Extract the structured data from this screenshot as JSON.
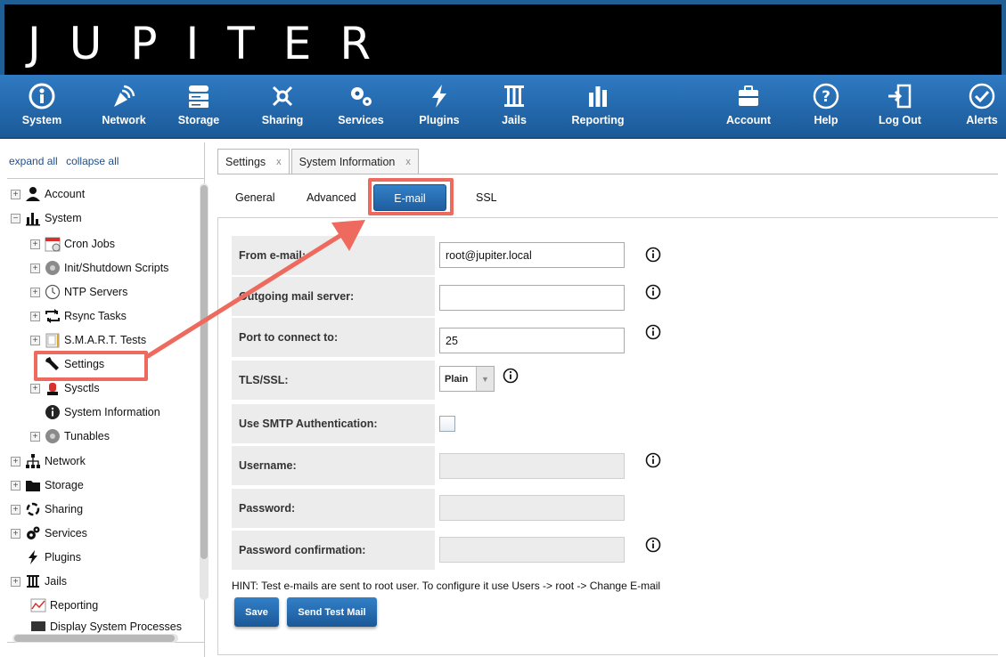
{
  "app": {
    "logo_text": "JUPITER",
    "brand_color": "#1f5f94"
  },
  "nav": {
    "items": [
      {
        "label": "System",
        "icon": "power-icon"
      },
      {
        "label": "Network",
        "icon": "satellite-icon"
      },
      {
        "label": "Storage",
        "icon": "disk-stack-icon"
      },
      {
        "label": "Sharing",
        "icon": "share-icon"
      },
      {
        "label": "Services",
        "icon": "gears-icon"
      },
      {
        "label": "Plugins",
        "icon": "lightning-icon"
      },
      {
        "label": "Jails",
        "icon": "jail-bars-icon"
      },
      {
        "label": "Reporting",
        "icon": "bar-chart-icon"
      },
      {
        "label": "Account",
        "icon": "account-icon"
      },
      {
        "label": "Help",
        "icon": "help-icon"
      },
      {
        "label": "Log Out",
        "icon": "logout-icon"
      },
      {
        "label": "Alerts",
        "icon": "check-circle-icon"
      }
    ]
  },
  "sidebar": {
    "expand_all": "expand all",
    "collapse_all": "collapse all",
    "tree": [
      {
        "label": "Account",
        "icon": "user-icon",
        "level": 0,
        "expander": "+"
      },
      {
        "label": "System",
        "icon": "chart-icon",
        "level": 0,
        "expander": "−"
      },
      {
        "label": "Cron Jobs",
        "icon": "calendar-icon",
        "level": 1,
        "expander": "+"
      },
      {
        "label": "Init/Shutdown Scripts",
        "icon": "disc-icon",
        "level": 1,
        "expander": "+"
      },
      {
        "label": "NTP Servers",
        "icon": "clock-icon",
        "level": 1,
        "expander": "+"
      },
      {
        "label": "Rsync Tasks",
        "icon": "sync-icon",
        "level": 1,
        "expander": "+"
      },
      {
        "label": "S.M.A.R.T. Tests",
        "icon": "drive-icon",
        "level": 1,
        "expander": "+"
      },
      {
        "label": "Settings",
        "icon": "wrench-icon",
        "level": 1,
        "expander": ""
      },
      {
        "label": "Sysctls",
        "icon": "beacon-icon",
        "level": 1,
        "expander": "+"
      },
      {
        "label": "System Information",
        "icon": "info-icon",
        "level": 1,
        "expander": ""
      },
      {
        "label": "Tunables",
        "icon": "disc-icon",
        "level": 1,
        "expander": "+"
      },
      {
        "label": "Network",
        "icon": "network-icon",
        "level": 0,
        "expander": "+"
      },
      {
        "label": "Storage",
        "icon": "folder-icon",
        "level": 0,
        "expander": "+"
      },
      {
        "label": "Sharing",
        "icon": "sharing-icon",
        "level": 0,
        "expander": "+"
      },
      {
        "label": "Services",
        "icon": "services-icon",
        "level": 0,
        "expander": "+"
      },
      {
        "label": "Plugins",
        "icon": "lightning-icon",
        "level": 0,
        "expander": ""
      },
      {
        "label": "Jails",
        "icon": "jail-bars-icon",
        "level": 0,
        "expander": "+"
      },
      {
        "label": "Reporting",
        "icon": "graph-icon",
        "level": 0,
        "expander": ""
      },
      {
        "label": "Display System Processes",
        "icon": "display-icon",
        "level": 0,
        "expander": ""
      }
    ]
  },
  "tabs": [
    {
      "label": "Settings",
      "close": "x"
    },
    {
      "label": "System Information",
      "close": "x"
    }
  ],
  "subtabs": {
    "general": "General",
    "advanced": "Advanced",
    "email": "E-mail",
    "ssl": "SSL"
  },
  "form": {
    "from_email_label": "From e-mail:",
    "from_email_value": "root@jupiter.local",
    "outgoing_label": "Outgoing mail server:",
    "outgoing_value": "",
    "port_label": "Port to connect to:",
    "port_value": "25",
    "tls_label": "TLS/SSL:",
    "tls_value": "Plain",
    "smtp_auth_label": "Use SMTP Authentication:",
    "smtp_auth_checked": false,
    "username_label": "Username:",
    "password_label": "Password:",
    "password_confirm_label": "Password confirmation:"
  },
  "hint": "HINT: Test e-mails are sent to root user. To configure it use Users -> root -> Change E-mail",
  "buttons": {
    "save": "Save",
    "send_test": "Send Test Mail"
  },
  "annotation_color": "#ee6a5e"
}
